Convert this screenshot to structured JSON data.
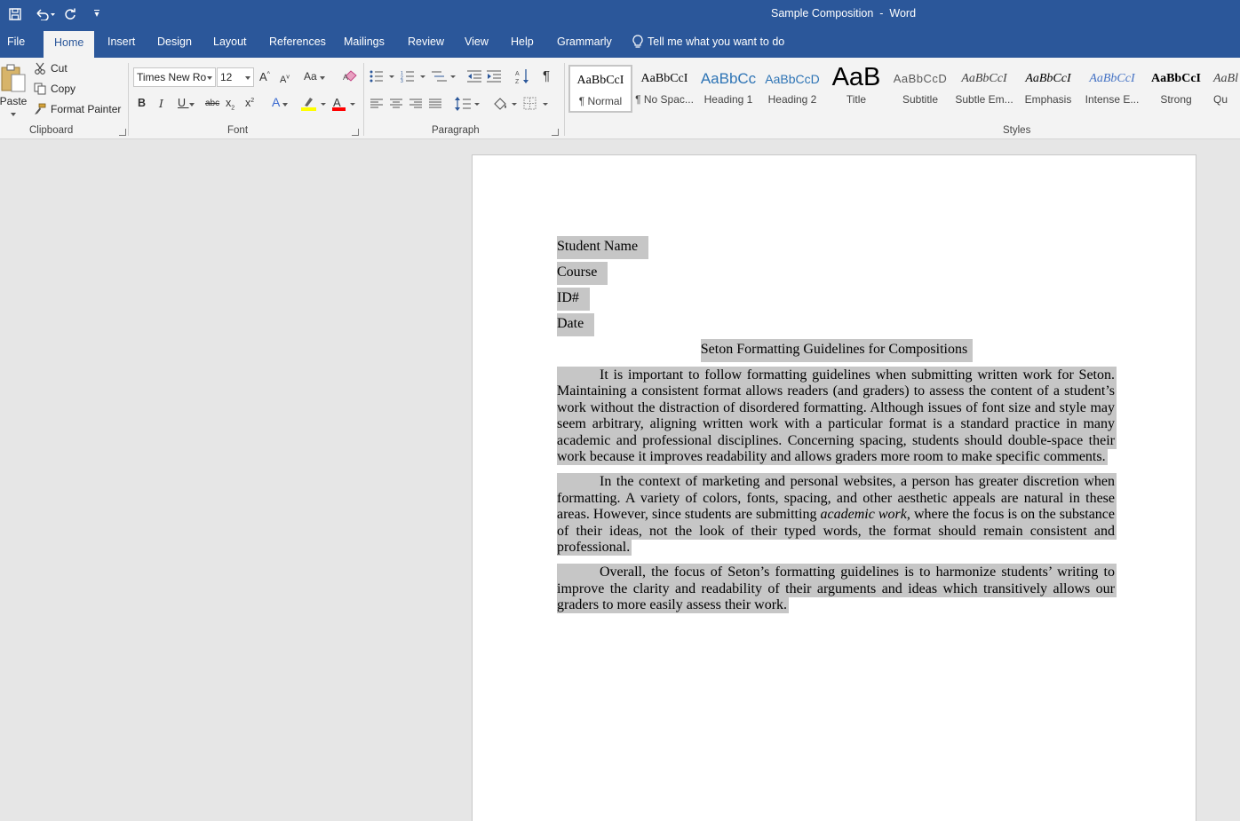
{
  "window": {
    "title": "Sample Composition  -  Word"
  },
  "qat": {
    "customize": "▾"
  },
  "tabs": [
    "File",
    "Home",
    "Insert",
    "Design",
    "Layout",
    "References",
    "Mailings",
    "Review",
    "View",
    "Help",
    "Grammarly"
  ],
  "tell_me": "Tell me what you want to do",
  "clipboard": {
    "paste": "Paste",
    "cut": "Cut",
    "copy": "Copy",
    "format_painter": "Format Painter",
    "label": "Clipboard"
  },
  "font": {
    "name": "Times New Ro",
    "size": "12",
    "label": "Font",
    "bold": "B",
    "italic": "I",
    "underline": "U",
    "strike": "abc",
    "change_case": "Aa",
    "font_color": "#ff0000",
    "highlight_color": "#ffff00"
  },
  "paragraph": {
    "label": "Paragraph"
  },
  "styles": {
    "label": "Styles",
    "items": [
      {
        "preview": "AaBbCcI",
        "label": "¶ Normal"
      },
      {
        "preview": "AaBbCcI",
        "label": "¶ No Spac..."
      },
      {
        "preview": "AaBbCc",
        "label": "Heading 1"
      },
      {
        "preview": "AaBbCcD",
        "label": "Heading 2"
      },
      {
        "preview": "AaB",
        "label": "Title"
      },
      {
        "preview": "AaBbCcD",
        "label": "Subtitle"
      },
      {
        "preview": "AaBbCcI",
        "label": "Subtle Em..."
      },
      {
        "preview": "AaBbCcI",
        "label": "Emphasis"
      },
      {
        "preview": "AaBbCcI",
        "label": "Intense E..."
      },
      {
        "preview": "AaBbCcI",
        "label": "Strong"
      },
      {
        "preview": "AaBl",
        "label": "Qu"
      }
    ]
  },
  "colors": {
    "ribbon_blue": "#2b579a",
    "selection": "#c6c6c6"
  },
  "document": {
    "header_lines": [
      "Student Name",
      "Course",
      "ID#",
      "Date"
    ],
    "title": "Seton Formatting Guidelines for Compositions",
    "p1": "It is important to follow formatting guidelines when submitting written work for Seton. Maintaining a consistent format allows readers (and graders) to assess the content of a student’s work without the distraction of disordered formatting. Although issues of font size and style may seem arbitrary, aligning written work with a particular format is a standard practice in many academic and professional disciplines. Concerning spacing, students should double-space their work because it improves readability and allows graders more room to make specific comments.",
    "p2_before": "In the context of marketing and personal websites, a person has greater discretion when formatting. A variety of colors, fonts, spacing, and other aesthetic appeals are natural in these areas. However, since students are submitting ",
    "p2_italic": "academic work",
    "p2_after": ", where the focus is on the substance of their ideas, not the look of their typed words, the format should remain consistent and professional.",
    "p3": "Overall, the focus of Seton’s formatting guidelines is to harmonize students’ writing to improve the clarity and readability of their arguments and ideas which transitively allows our graders to more easily assess their work."
  }
}
